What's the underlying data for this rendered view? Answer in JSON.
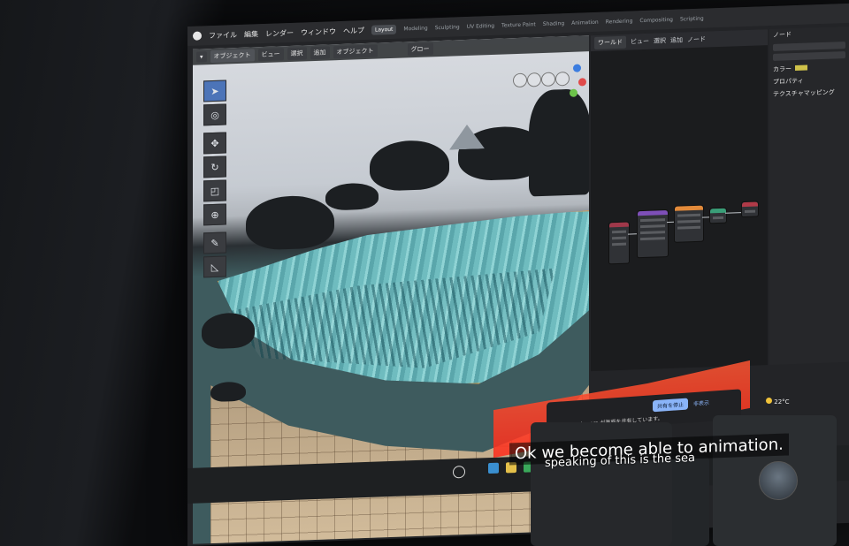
{
  "menubar": {
    "menus": [
      "ファイル",
      "編集",
      "レンダー",
      "ウィンドウ",
      "ヘルプ"
    ],
    "workspaces": [
      "Layout",
      "Modeling",
      "Sculpting",
      "UV Editing",
      "Texture Paint",
      "Shading",
      "Animation",
      "Rendering",
      "Compositing",
      "Scripting"
    ],
    "active_workspace": "Layout"
  },
  "viewport": {
    "mode": "オブジェクト",
    "menus": [
      "ビュー",
      "選択",
      "追加",
      "オブジェクト"
    ],
    "orientation": "グロー"
  },
  "node_editor": {
    "header": [
      "ワールド",
      "ビュー",
      "選択",
      "追加",
      "ノード"
    ]
  },
  "properties": {
    "sections": [
      "ノード",
      "カラー",
      "プロパティ",
      "テクスチャマッピング"
    ]
  },
  "subtitles": {
    "line1": "Ok we become able to animation.",
    "line2": "speaking of this is the sea"
  },
  "meet": {
    "url": "meet.google.com が画面を共有しています。",
    "stop_label": "共有を停止",
    "hide_label": "非表示"
  },
  "weather": {
    "temp": "22°C"
  }
}
